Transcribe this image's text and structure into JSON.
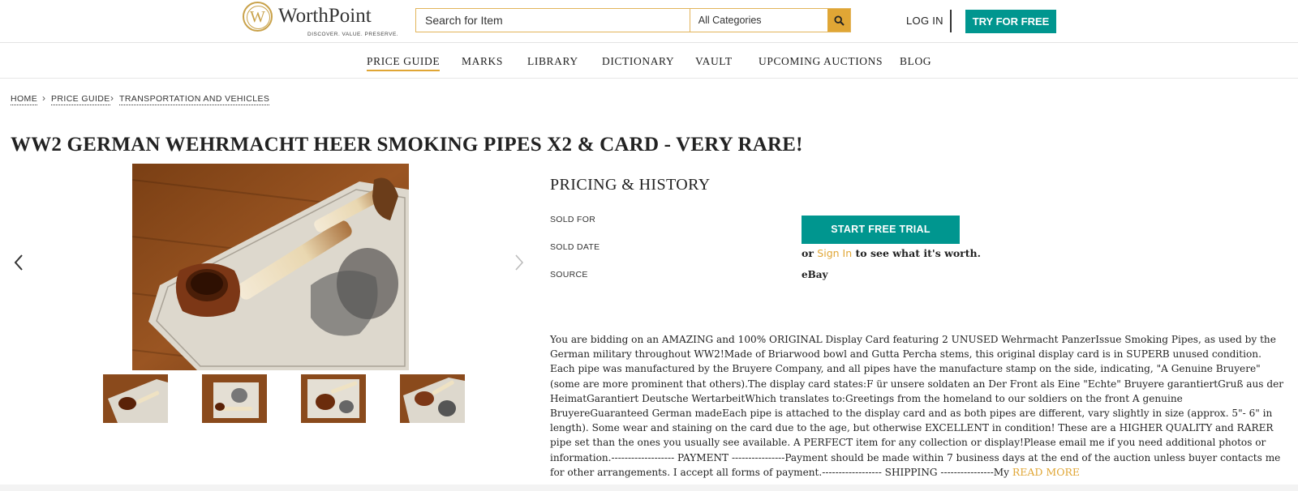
{
  "brand": {
    "name": "WorthPoint",
    "mark": "W",
    "tagline": "DISCOVER. VALUE. PRESERVE."
  },
  "search": {
    "placeholder": "Search for Item",
    "category": "All Categories"
  },
  "header": {
    "login": "LOG IN",
    "try_free": "TRY FOR FREE"
  },
  "nav": [
    "PRICE GUIDE",
    "MARKS",
    "LIBRARY",
    "DICTIONARY",
    "VAULT",
    "UPCOMING AUCTIONS",
    "BLOG"
  ],
  "breadcrumb": [
    "HOME",
    "PRICE GUIDE",
    "TRANSPORTATION AND VEHICLES"
  ],
  "item": {
    "title": "WW2 GERMAN WEHRMACHT HEER SMOKING PIPES X2 & CARD - VERY RARE!",
    "thumbnail_count": 4
  },
  "pricing": {
    "heading": "PRICING & HISTORY",
    "sold_for_label": "SOLD FOR",
    "sold_date_label": "SOLD DATE",
    "source_label": "SOURCE",
    "trial_button": "START FREE TRIAL",
    "or": "or",
    "sign_in": "Sign In",
    "see_worth": "to see what it's worth.",
    "source_value": "eBay"
  },
  "description": {
    "text": "You are bidding on an AMAZING and 100% ORIGINAL Display Card featuring 2 UNUSED Wehrmacht PanzerIssue Smoking Pipes, as used by the German military throughout WW2!Made of Briarwood bowl and Gutta Percha stems, this original display card is in SUPERB unused condition. Each pipe was manufactured by the Bruyere Company, and all pipes have the manufacture stamp on the side, indicating, \"A Genuine Bruyere\" (some are more prominent that others).The display card states:F ür unsere soldaten an Der Front als Eine \"Echte\" Bruyere garantiertGruß aus der HeimatGarantiert Deutsche WertarbeitWhich translates to:Greetings from the homeland to our soldiers on the front A genuine BruyereGuaranteed German madeEach pipe is attached to the display card and as both pipes are different, vary slightly in size (approx. 5\"- 6\" in length). Some wear and staining on the card due to the age, but otherwise EXCELLENT in condition! These are a HIGHER QUALITY and RARER pipe set than the ones you usually see available. A PERFECT item for any collection or display!Please email me if you need additional photos or information.------------------- PAYMENT ----------------Payment should be made within 7 business days at the end of the auction unless buyer contacts me for other arrangements. I accept all forms of payment.------------------ SHIPPING ----------------My ",
    "read_more": "READ MORE"
  },
  "icons": {
    "search": "search-icon",
    "prev": "chevron-left-icon",
    "next": "chevron-right-icon"
  },
  "colors": {
    "teal": "#00968f",
    "gold": "#e0a635"
  }
}
